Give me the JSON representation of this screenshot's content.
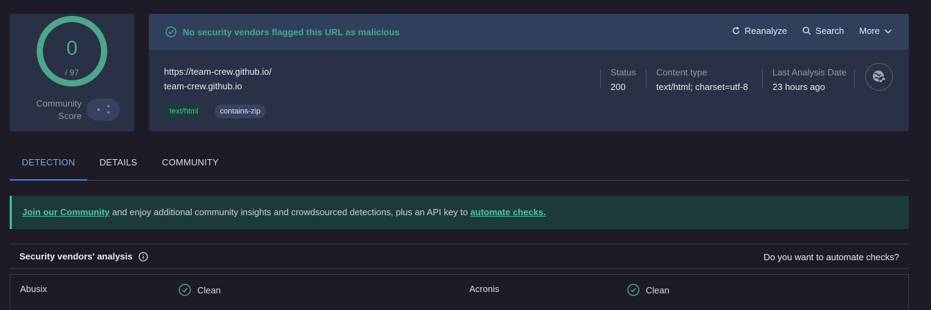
{
  "score": {
    "detections": "0",
    "total": "/ 97",
    "community_label_line1": "Community",
    "community_label_line2": "Score"
  },
  "banner": {
    "message": "No security vendors flagged this URL as malicious",
    "actions": {
      "reanalyze": "Reanalyze",
      "search": "Search",
      "more": "More"
    }
  },
  "url": {
    "full": "https://team-crew.github.io/",
    "domain": "team-crew.github.io"
  },
  "tags": [
    "text/html",
    "contains-zip"
  ],
  "meta": {
    "status_label": "Status",
    "status_value": "200",
    "content_type_label": "Content type",
    "content_type_value": "text/html; charset=utf-8",
    "last_analysis_label": "Last Analysis Date",
    "last_analysis_value": "23 hours ago"
  },
  "tabs": [
    "DETECTION",
    "DETAILS",
    "COMMUNITY"
  ],
  "community_banner": {
    "link1": "Join our Community",
    "middle": " and enjoy additional community insights and crowdsourced detections, plus an API key to ",
    "link2": "automate checks."
  },
  "analysis": {
    "title": "Security vendors' analysis",
    "cta": "Do you want to automate checks?"
  },
  "vendors": [
    {
      "name": "Abusix",
      "result": "Clean"
    },
    {
      "name": "Acronis",
      "result": "Clean"
    }
  ],
  "colors": {
    "accent_green": "#4fa58c",
    "accent_blue": "#4d7fe0",
    "card_bg": "#283145"
  }
}
